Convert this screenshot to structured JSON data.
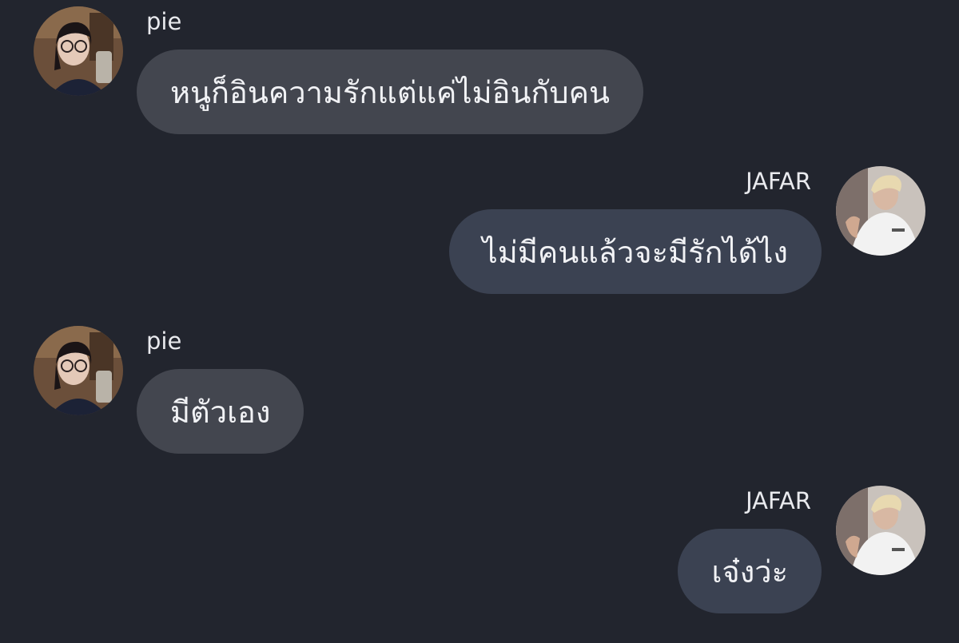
{
  "messages": [
    {
      "sender": "pie",
      "text": "หนูก็อินความรักแต่แค่ไม่อินกับคน",
      "direction": "incoming"
    },
    {
      "sender": "JAFAR",
      "text": "ไม่มีคนแล้วจะมีรักได้ไง",
      "direction": "outgoing"
    },
    {
      "sender": "pie",
      "text": "มีตัวเอง",
      "direction": "incoming"
    },
    {
      "sender": "JAFAR",
      "text": "เจ๋งว่ะ",
      "direction": "outgoing"
    }
  ],
  "colors": {
    "background": "#22252e",
    "incoming_bubble": "#43464f",
    "outgoing_bubble": "#3b4252",
    "text": "#f1f2f5"
  }
}
